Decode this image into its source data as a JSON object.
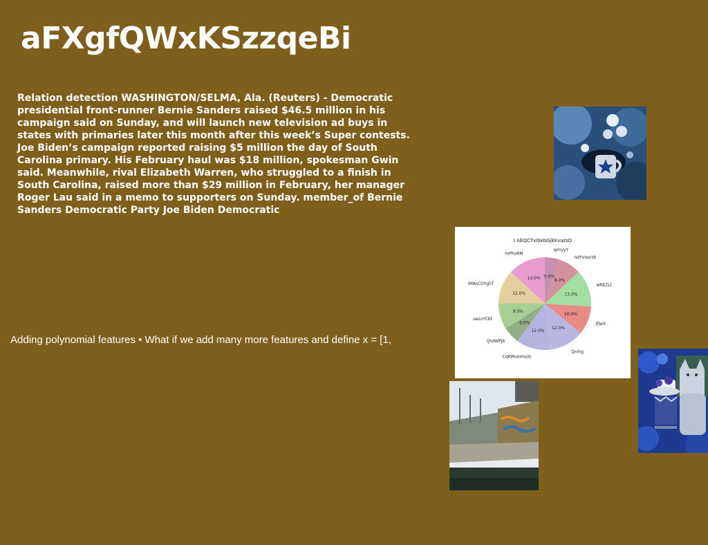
{
  "page": {
    "title": "aFXgfQWxKSzzqeBi",
    "body_text": "Relation detection WASHINGTON/SELMA, Ala. (Reuters) - Democratic presidential front-runner Bernie Sanders raised $46.5 million in his campaign said on Sunday, and will launch new television ad buys in states with primaries later this month after this week’s Super contests. Joe Biden’s campaign reported raising $5 million the day of South Carolina primary. His February haul was $18 million, spokesman Gwin said. Meanwhile, rival Elizabeth Warren, who struggled to a finish in South Carolina, raised more than $29 million in February, her manager Roger Lau said in a memo to supporters on Sunday. member_of Bernie Sanders Democratic Party Joe Biden Democratic",
    "caption": "Adding polynomial features • What if we add many more features and define x = [1,"
  },
  "images": {
    "teacup_blue": "photo of a white mug with a blue star among blue flowers",
    "bridge": "photo of a bridge walkway with graffiti wall",
    "cat_teacup": "photo of a cat figurine with a teacup among blue flowers"
  },
  "chart_data": {
    "type": "pie",
    "title": "I AEQCTxlbkbGjKkvazsD",
    "slices": [
      {
        "label": "ajmyyY",
        "value": 5.0,
        "pct_label": "5.0%",
        "color": "#c68fb0"
      },
      {
        "label": "ndYVxorzb",
        "value": 8.0,
        "pct_label": "8.0%",
        "color": "#d4929c"
      },
      {
        "label": "wREZLl",
        "value": 13.0,
        "pct_label": "13.0%",
        "color": "#a3dea3"
      },
      {
        "label": "jfjwX",
        "value": 10.0,
        "pct_label": "10.0%",
        "color": "#e88a86"
      },
      {
        "label": "Qnihg",
        "value": 12.0,
        "pct_label": "12.0%",
        "color": "#b9b7e1"
      },
      {
        "label": "CqKWuomszG",
        "value": 12.0,
        "pct_label": "12.0%",
        "color": "#b5b3df"
      },
      {
        "label": "rjhdWPJb",
        "value": 6.0,
        "pct_label": "6.0%",
        "color": "#93ad87"
      },
      {
        "label": "uezvYCKt",
        "value": 9.0,
        "pct_label": "9.0%",
        "color": "#a8cf96"
      },
      {
        "label": "lMAsCGYghT",
        "value": 12.0,
        "pct_label": "12.0%",
        "color": "#e3cf9d"
      },
      {
        "label": "mPhoRM",
        "value": 13.0,
        "pct_label": "13.0%",
        "color": "#e79ccf"
      }
    ]
  }
}
